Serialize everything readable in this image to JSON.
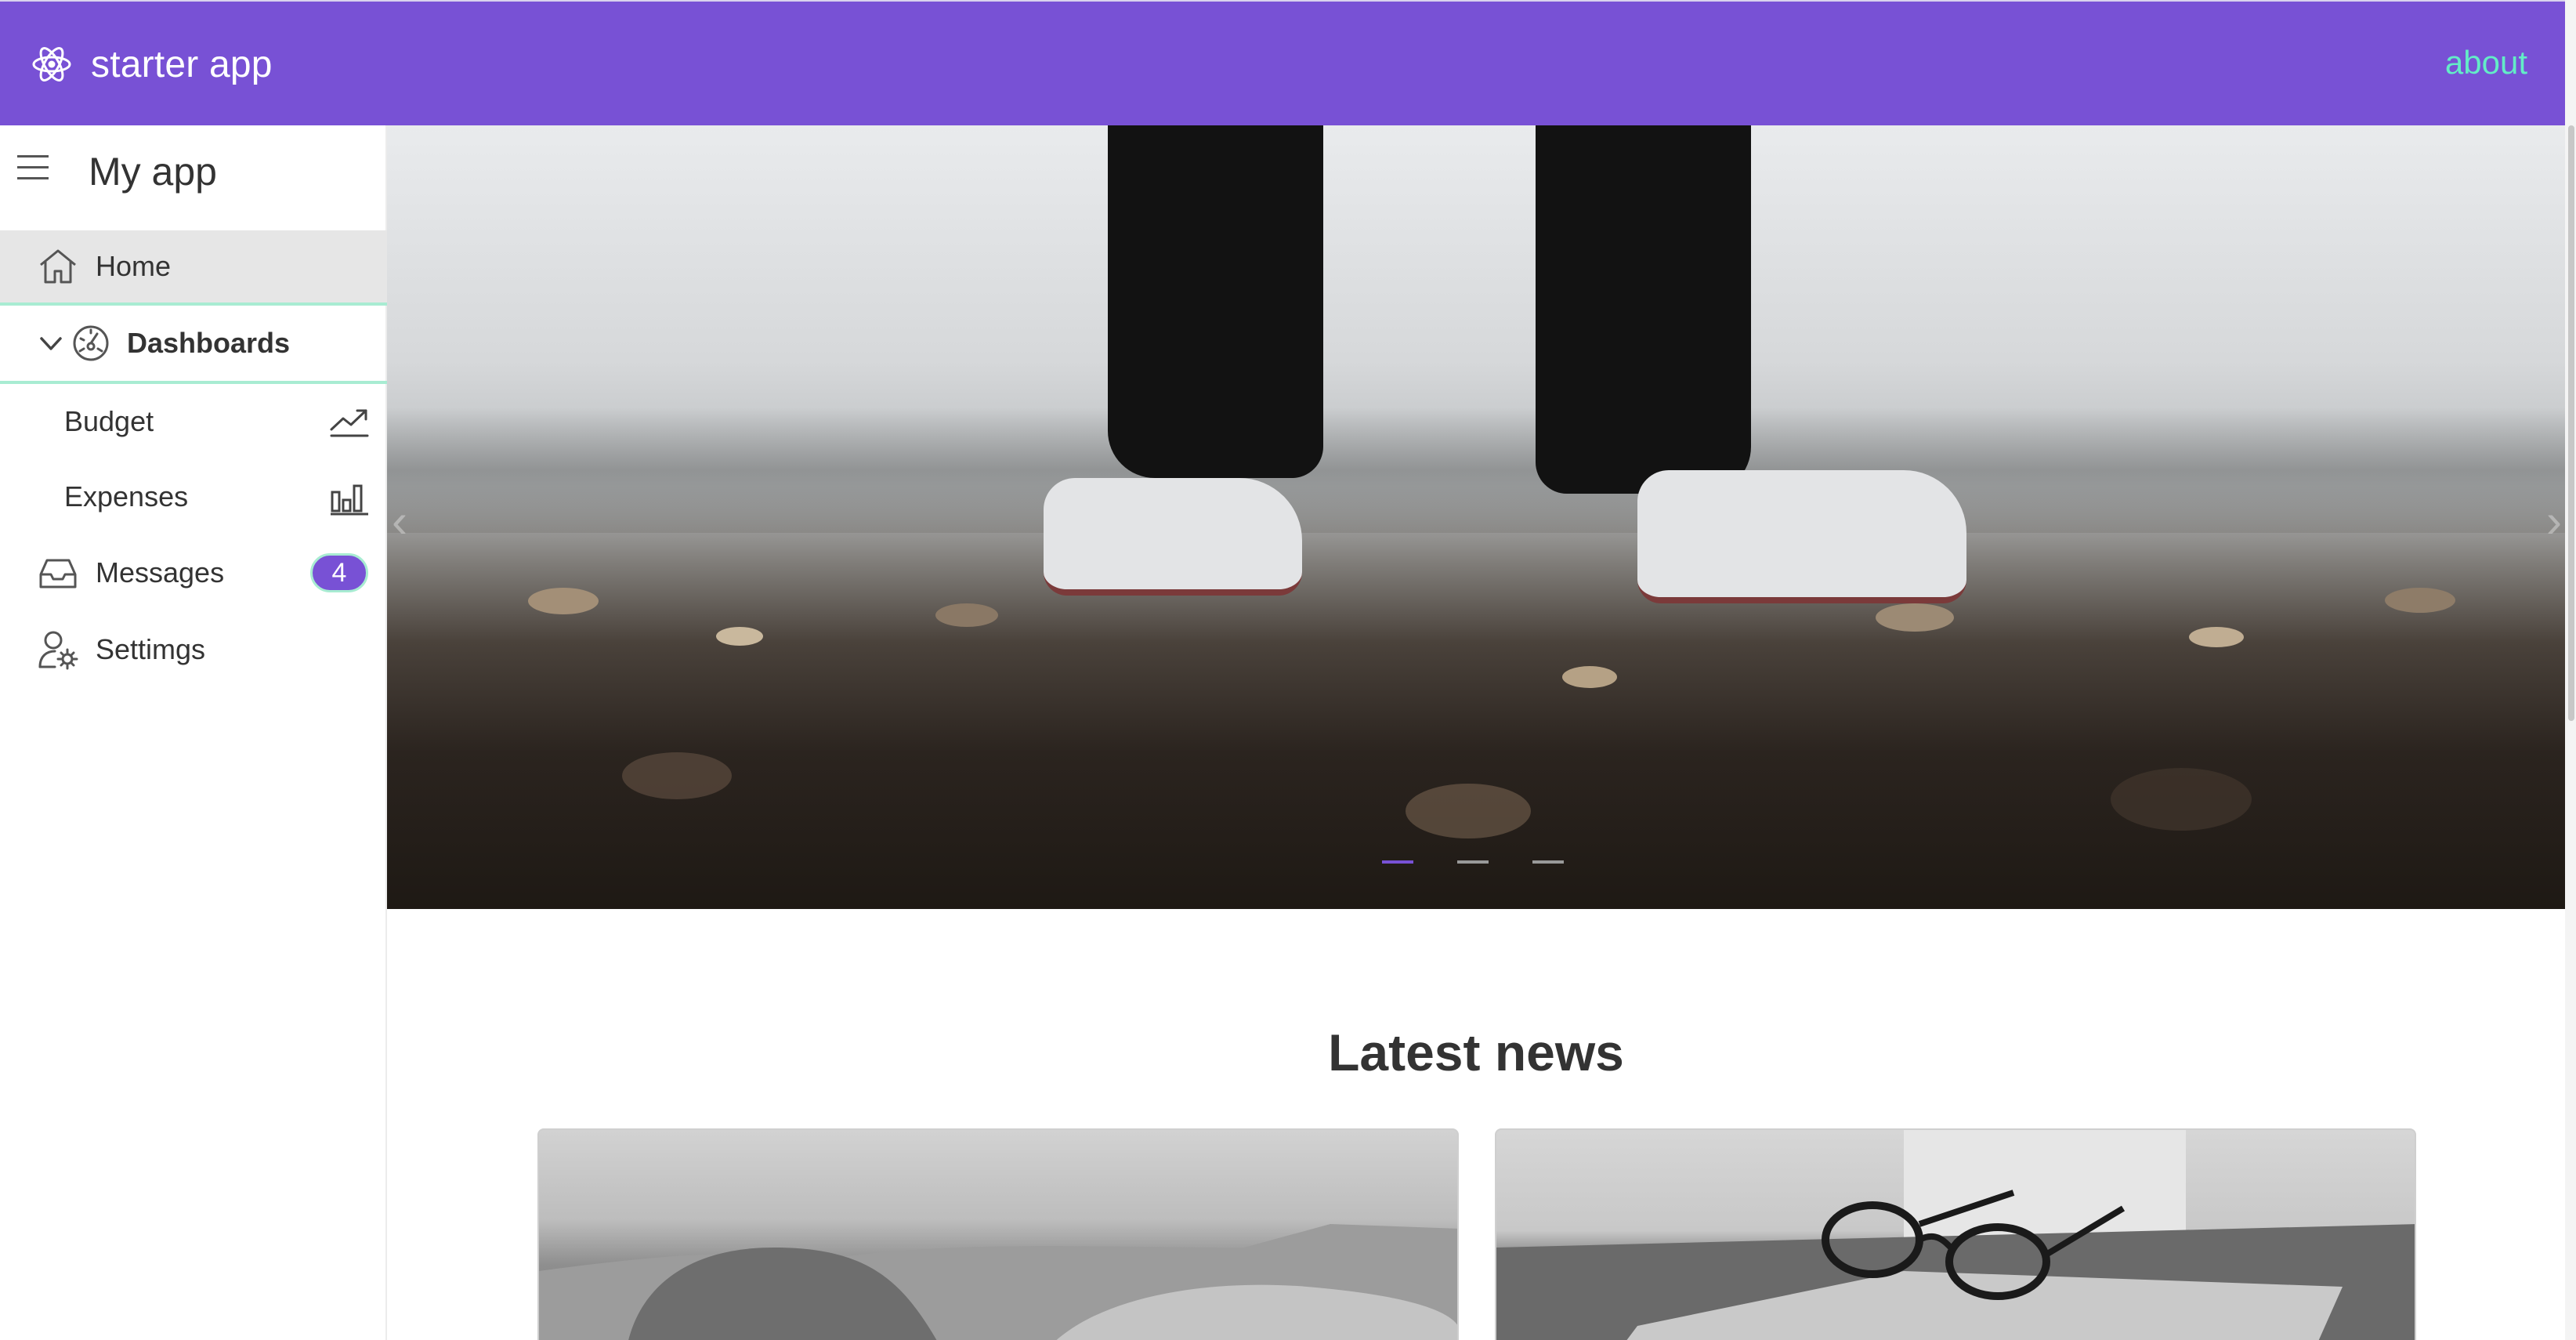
{
  "header": {
    "brand_icon": "react-atom-icon",
    "title": "starter app",
    "about_label": "about",
    "background_color": "#7851d5",
    "link_color": "#63ecc7"
  },
  "sidebar": {
    "title": "My app",
    "menu_icon": "hamburger-menu-icon",
    "items": [
      {
        "label": "Home",
        "icon": "home-icon",
        "selected": true
      },
      {
        "label": "Dashboards",
        "icon": "dashboard-gauge-icon",
        "expanded": true,
        "toggle_icon": "chevron-down-icon"
      },
      {
        "label": "Budget",
        "icon": "trending-up-icon",
        "sub_item": true
      },
      {
        "label": "Expenses",
        "icon": "bar-chart-icon",
        "sub_item": true
      },
      {
        "label": "Messages",
        "icon": "inbox-icon",
        "badge": "4"
      },
      {
        "label": "Settimgs",
        "icon": "user-settings-icon"
      }
    ]
  },
  "carousel": {
    "slide_count": 3,
    "active_index": 0,
    "prev_icon": "chevron-left-icon",
    "next_icon": "chevron-right-icon"
  },
  "news": {
    "title": "Latest news",
    "cards": [
      {
        "image": "highland-cattle-photo"
      },
      {
        "image": "glasses-on-laptop-photo"
      }
    ]
  }
}
